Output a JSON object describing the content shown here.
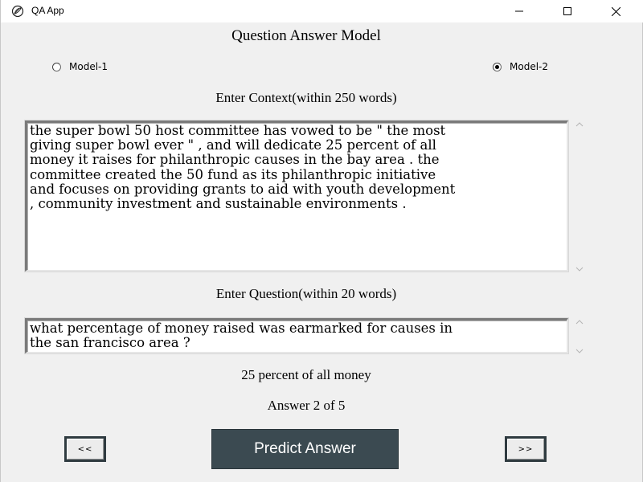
{
  "window": {
    "title": "QA App",
    "icons": {
      "app": "feather-icon",
      "minimize": "minimize-icon",
      "maximize": "maximize-icon",
      "close": "close-icon"
    }
  },
  "main": {
    "title": "Question Answer Model",
    "models": [
      {
        "label": "Model-1",
        "selected": false
      },
      {
        "label": "Model-2",
        "selected": true
      }
    ],
    "context": {
      "label": "Enter Context(within 250 words)",
      "value": "the super bowl 50 host committee has vowed to be \" the most\ngiving super bowl ever \" , and will dedicate 25 percent of all\nmoney it raises for philanthropic causes in the bay area . the\ncommittee created the 50 fund as its philanthropic initiative\nand focuses on providing grants to aid with youth development\n, community investment and sustainable environments ."
    },
    "question": {
      "label": "Enter Question(within 20 words)",
      "value": "what percentage of money raised was earmarked for causes in\nthe san francisco area ?"
    },
    "answer": {
      "text": "25 percent of all money",
      "count": "Answer 2 of 5"
    },
    "buttons": {
      "prev": "<<",
      "predict": "Predict Answer",
      "next": ">>"
    }
  },
  "colors": {
    "background": "#f0f0f0",
    "button_dark": "#3b4a51",
    "button_text": "#ffffff"
  }
}
